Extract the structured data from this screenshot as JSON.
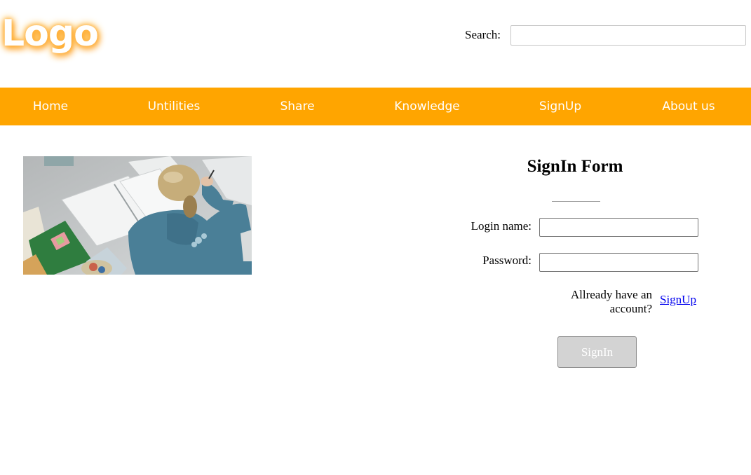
{
  "header": {
    "logo": "Logo",
    "search_label": "Search:",
    "search_value": ""
  },
  "nav": {
    "color": "#ffa500",
    "items": [
      {
        "label": "Home"
      },
      {
        "label": "Untilities"
      },
      {
        "label": "Share"
      },
      {
        "label": "Knowledge"
      },
      {
        "label": "SignUp"
      },
      {
        "label": "About us"
      }
    ]
  },
  "form": {
    "title": "SignIn Form",
    "login_label": "Login name:",
    "login_value": "",
    "password_label": "Password:",
    "password_value": "",
    "account_text": "Allready have an account?",
    "signup_link": "SignUp",
    "signin_button": "SignIn"
  },
  "photo": {
    "icon": "student-studying-photo"
  }
}
